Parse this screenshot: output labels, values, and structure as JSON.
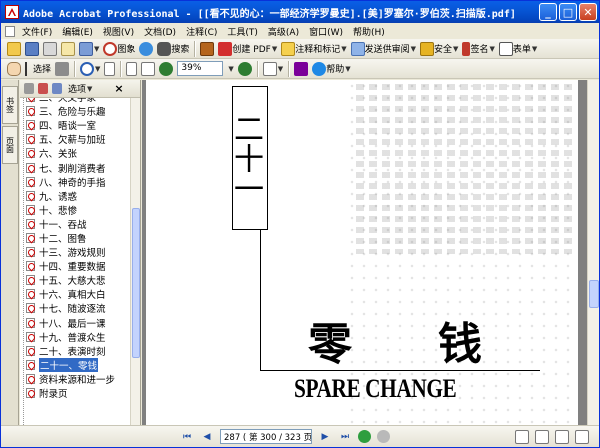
{
  "window": {
    "title": "Adobe Acrobat Professional - [[看不见的心：一部经济学罗曼史].[美]罗塞尔·罗伯茨.扫描版.pdf]",
    "minimize": "_",
    "restore": "□",
    "close": "✕"
  },
  "menu": [
    "文件(F)",
    "编辑(E)",
    "视图(V)",
    "文档(D)",
    "注释(C)",
    "工具(T)",
    "高级(A)",
    "窗口(W)",
    "帮助(H)"
  ],
  "toolbar1": {
    "find_label": "图象",
    "search_label": "搜索",
    "create_pdf": "创建 PDF",
    "comment_markup": "注释和标记",
    "send_review": "发送供审阅",
    "security": "安全",
    "sign": "签名",
    "forms": "表单"
  },
  "toolbar2": {
    "select_label": "选择",
    "zoom_value": "39%",
    "help_label": "帮助"
  },
  "sidebar": {
    "tabs": [
      "书签",
      "页面"
    ],
    "options_label": "选项",
    "close": "×",
    "bookmarks": [
      "二、天文学家",
      "三、危险与乐趣",
      "四、晤谈一室",
      "五、欠薪与加班",
      "六、关张",
      "七、剥削消费者",
      "八、神奇的手指",
      "九、诱惑",
      "十、悲惨",
      "十一、吞战",
      "十二、图鲁",
      "十三、游戏规则",
      "十四、重要数据",
      "十五、大慈大悲",
      "十六、真相大白",
      "十七、随波逐流",
      "十八、最后一课",
      "十九、普渡众生",
      "二十、表演时刻",
      "二十一、零钱",
      "资料来源和进一步",
      "附录页"
    ],
    "selected_index": 19
  },
  "page": {
    "chapter_number": "二十一",
    "title_zh": "零钱",
    "title_en": "SPARE CHANGE"
  },
  "statusbar": {
    "page_display": "287 ( 第 300 / 323 页 )"
  },
  "colors": {
    "titlebar": "#0A5FE6",
    "selection": "#316AC5",
    "chrome": "#ECE9D8"
  }
}
